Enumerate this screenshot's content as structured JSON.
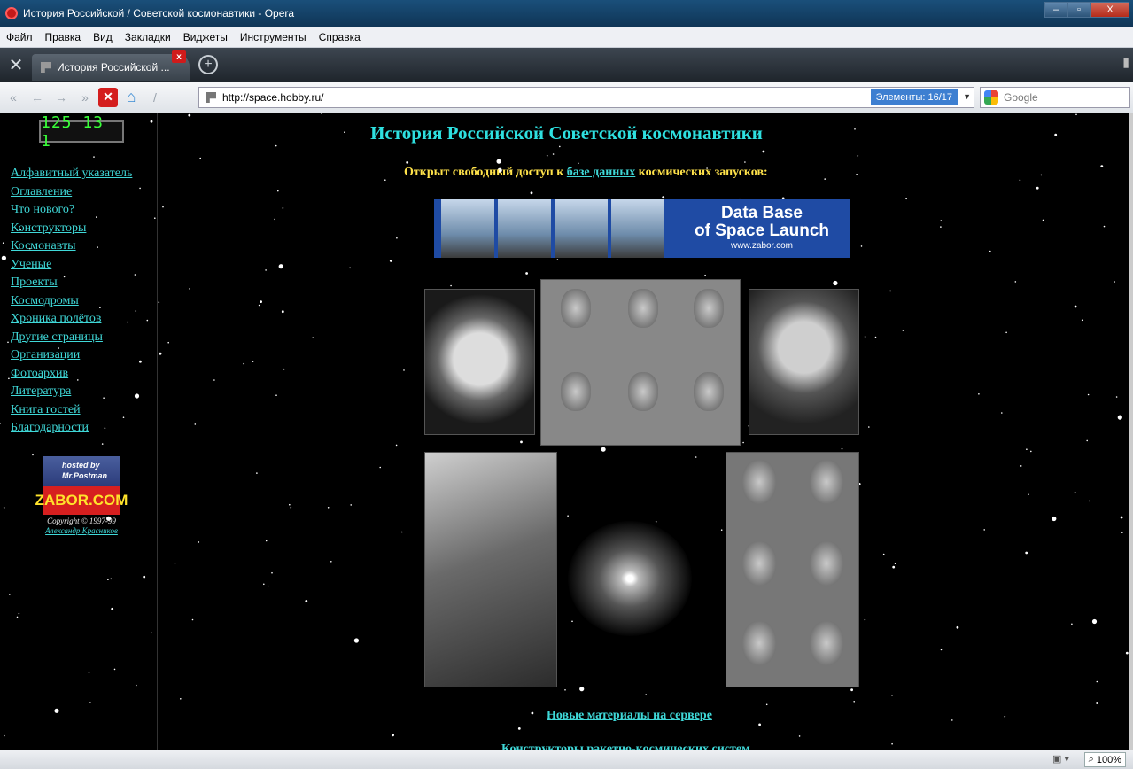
{
  "window": {
    "title": "История Российской / Советской космонавтики - Opera",
    "controls": {
      "min": "–",
      "max": "▫",
      "close": "X"
    }
  },
  "menu": [
    "Файл",
    "Правка",
    "Вид",
    "Закладки",
    "Виджеты",
    "Инструменты",
    "Справка"
  ],
  "tabs": [
    {
      "label": "История Российской ...",
      "close": "x"
    }
  ],
  "new_tab": "+",
  "nav": {
    "url": "http://space.hobby.ru/",
    "elements_label": "Элементы: 16/17",
    "search_placeholder": "Google"
  },
  "sidebar": {
    "counter": "125 13 1",
    "links": [
      "Алфавитный указатель",
      "Оглавление",
      "Что нового?",
      "Конструкторы",
      "Космонавты",
      "Ученые",
      "Проекты",
      "Космодромы",
      "Хроника полётов",
      "Другие страницы",
      "Организации",
      "Фотоархив",
      "Литература",
      "Книга гостей",
      "Благодарности"
    ],
    "hosted": {
      "top": "hosted by Mr.Postman",
      "bottom": "ZABOR.COM"
    },
    "copyright": "Copyright © 1997-99",
    "author": "Александр Красников"
  },
  "main": {
    "title": "История Российской Советской космонавтики",
    "open_prefix": "Открыт свободный доступ к ",
    "open_link": "базе данных",
    "open_suffix": " космических запусков:",
    "banner": {
      "line1": "Data Base",
      "line2": "of Space Launch",
      "url": "www.zabor.com"
    },
    "new_materials": "Новые материалы на сервере",
    "constructors": "Конструкторы ракетно-космических систем"
  },
  "status": {
    "zoom": "100%"
  },
  "colors": {
    "link": "#3fd8d8",
    "headline": "#ffe24a",
    "title": "#2ee0e0",
    "background": "#000000"
  }
}
